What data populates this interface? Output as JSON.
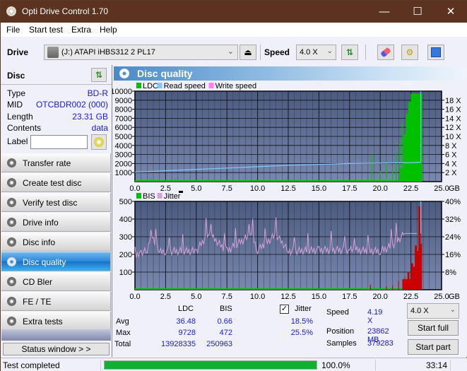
{
  "window": {
    "title": "Opti Drive Control 1.70",
    "controls": {
      "minimize": "—",
      "maximize": "☐",
      "close": "✕"
    }
  },
  "menu": [
    "File",
    "Start test",
    "Extra",
    "Help"
  ],
  "toolbar": {
    "drive_label": "Drive",
    "drive_value": "(J:)  ATAPI iHBS312  2 PL17",
    "speed_label": "Speed",
    "speed_value": "4.0 X",
    "icons": [
      "eject-icon",
      "refresh-icon",
      "erase-icon",
      "settings-icon",
      "save-icon"
    ]
  },
  "disc": {
    "title": "Disc",
    "rows": [
      {
        "key": "Type",
        "value": "BD-R"
      },
      {
        "key": "MID",
        "value": "OTCBDR002 (000)"
      },
      {
        "key": "Length",
        "value": "23.31 GB"
      },
      {
        "key": "Contents",
        "value": "data"
      }
    ],
    "label_key": "Label",
    "label_value": ""
  },
  "nav": [
    {
      "label": "Transfer rate",
      "active": false
    },
    {
      "label": "Create test disc",
      "active": false
    },
    {
      "label": "Verify test disc",
      "active": false
    },
    {
      "label": "Drive info",
      "active": false
    },
    {
      "label": "Disc info",
      "active": false
    },
    {
      "label": "Disc quality",
      "active": true
    },
    {
      "label": "CD Bler",
      "active": false
    },
    {
      "label": "FE / TE",
      "active": false
    },
    {
      "label": "Extra tests",
      "active": false
    }
  ],
  "status_window_label": "Status window > >",
  "panel_title": "Disc quality",
  "colors": {
    "ldc": "#00c000",
    "read_speed": "#80c8ff",
    "write_speed": "#ff80ff",
    "bis_low": "#00c000",
    "bis_high": "#cc0000",
    "jitter": "#d8a0d8",
    "plot_bg_top": "#4a5a80",
    "plot_bg_bottom": "#7888b0",
    "progress": "#10b030"
  },
  "chart_data": [
    {
      "type": "bar",
      "title": "LDC / Read speed",
      "legend": [
        "LDC",
        "Read speed",
        "Write speed"
      ],
      "legend_position": "top-left",
      "xlabel": "GB",
      "x_ticks": [
        "0.0",
        "2.5",
        "5.0",
        "7.5",
        "10.0",
        "12.5",
        "15.0",
        "17.5",
        "20.0",
        "22.5",
        "25.0"
      ],
      "xlim": [
        0,
        25
      ],
      "y_left_ticks": [
        "1000",
        "2000",
        "3000",
        "4000",
        "5000",
        "6000",
        "7000",
        "8000",
        "9000",
        "10000"
      ],
      "ylim_left": [
        0,
        10000
      ],
      "y_right_ticks": [
        "2 X",
        "4 X",
        "6 X",
        "8 X",
        "10 X",
        "12 X",
        "14 X",
        "16 X",
        "18 X"
      ],
      "ylim_right": [
        0,
        20
      ],
      "grid": true,
      "series": [
        {
          "name": "LDC",
          "x": [
            0.5,
            1.3,
            2.0,
            3.3,
            5.0,
            7.0,
            10.0,
            12.0,
            15.0,
            17.0,
            19.0,
            19.3,
            20.0,
            20.5,
            21.0,
            21.3,
            21.6,
            21.8,
            22.0,
            22.2,
            22.4,
            22.6,
            22.8,
            23.0,
            23.2,
            23.31
          ],
          "values": [
            150,
            400,
            120,
            300,
            80,
            100,
            80,
            120,
            100,
            120,
            200,
            3000,
            1200,
            2200,
            1500,
            3200,
            4500,
            6500,
            5200,
            7500,
            8800,
            9728,
            9600,
            9700,
            9650,
            9728
          ]
        },
        {
          "name": "Read speed",
          "x": [
            0,
            2.5,
            5.0,
            7.5,
            10.0,
            12.5,
            15.0,
            17.5,
            20.0,
            22.5,
            23.31
          ],
          "values": [
            2.1,
            2.4,
            2.7,
            3.0,
            3.3,
            3.6,
            3.8,
            4.0,
            4.1,
            4.2,
            4.3
          ]
        }
      ]
    },
    {
      "type": "bar",
      "title": "BIS / Jitter",
      "legend": [
        "BIS",
        "Jitter"
      ],
      "legend_position": "top-left",
      "xlabel": "GB",
      "x_ticks": [
        "0.0",
        "2.5",
        "5.0",
        "7.5",
        "10.0",
        "12.5",
        "15.0",
        "17.5",
        "20.0",
        "22.5",
        "25.0"
      ],
      "xlim": [
        0,
        25
      ],
      "y_left_ticks": [
        "100",
        "200",
        "300",
        "400",
        "500"
      ],
      "ylim_left": [
        0,
        500
      ],
      "y_right_ticks": [
        "8%",
        "16%",
        "24%",
        "32%",
        "40%"
      ],
      "ylim_right": [
        0,
        40
      ],
      "grid": true,
      "series": [
        {
          "name": "BIS",
          "x": [
            19.2,
            20.5,
            21.0,
            21.5,
            22.0,
            22.3,
            22.6,
            22.9,
            23.1,
            23.2,
            23.31
          ],
          "values": [
            30,
            20,
            25,
            50,
            70,
            100,
            150,
            250,
            200,
            472,
            260
          ]
        },
        {
          "name": "Jitter",
          "x": [
            0,
            0.5,
            1.0,
            1.3,
            2.0,
            2.5,
            5.0,
            6.0,
            7.5,
            9.5,
            10.0,
            11.5,
            12.5,
            15.0,
            17.5,
            20.0,
            21.0,
            22.0,
            23.0
          ],
          "values": [
            14,
            17,
            17.5,
            25.5,
            17,
            17.5,
            17.5,
            25.5,
            17.5,
            25,
            18,
            25,
            17.5,
            18,
            18,
            17.5,
            20,
            25.5,
            25.5
          ]
        }
      ]
    }
  ],
  "stats": {
    "headers": [
      "LDC",
      "BIS"
    ],
    "jitter_label": "Jitter",
    "jitter_checked": true,
    "rows": [
      {
        "label": "Avg",
        "ldc": "36.48",
        "bis": "0.66",
        "jitter": "18.5%"
      },
      {
        "label": "Max",
        "ldc": "9728",
        "bis": "472",
        "jitter": "25.5%"
      },
      {
        "label": "Total",
        "ldc": "13928335",
        "bis": "250963",
        "jitter": ""
      }
    ],
    "speed_label": "Speed",
    "speed_value": "4.19 X",
    "position_label": "Position",
    "position_value": "23862 MB",
    "samples_label": "Samples",
    "samples_value": "379283",
    "speed_select": "4.0 X",
    "start_full": "Start full",
    "start_part": "Start part"
  },
  "statusbar": {
    "status": "Test completed",
    "progress": 100.0,
    "progress_text": "100.0%",
    "time": "33:14"
  }
}
